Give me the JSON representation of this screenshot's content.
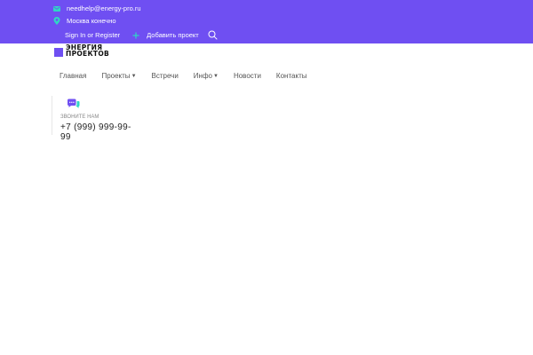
{
  "topbar": {
    "email": "needhelp@energy-pro.ru",
    "address": "Москва конечно",
    "signin_label": "Sign In or Register",
    "add_project_label": "Добавить проект",
    "icons": {
      "email": "mail-icon",
      "address": "map-pin-icon",
      "add": "plus-icon",
      "search": "search-icon"
    }
  },
  "logo": {
    "line1": "ЭНЕРГИЯ",
    "line2": "ПРОЕКТОВ"
  },
  "nav": {
    "items": [
      {
        "label": "Главная"
      },
      {
        "label": "Проекты"
      },
      {
        "label": "Встречи"
      },
      {
        "label": "Инфо"
      },
      {
        "label": "Новости"
      },
      {
        "label": "Контакты"
      }
    ]
  },
  "contact": {
    "label": "ЗВОНИТЕ НАМ",
    "phone": "+7 (999) 999-99-99",
    "icon": "chat-icon"
  },
  "colors": {
    "brand": "#6f4ff2",
    "accent": "#2fd6c4"
  }
}
